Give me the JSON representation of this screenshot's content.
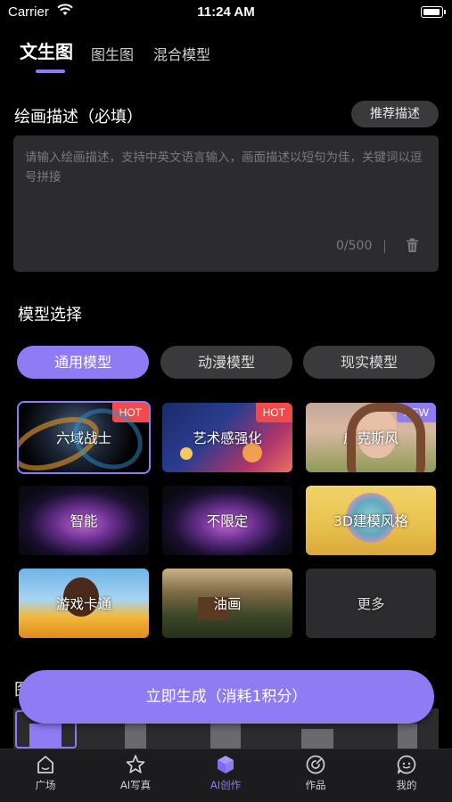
{
  "status": {
    "carrier": "Carrier",
    "time": "11:24 AM"
  },
  "tabs": [
    {
      "label": "文生图",
      "active": true
    },
    {
      "label": "图生图",
      "active": false
    },
    {
      "label": "混合模型",
      "active": false
    }
  ],
  "description": {
    "title": "绘画描述（必填）",
    "recommend_label": "推荐描述",
    "placeholder": "请输入绘画描述，支持中英文语言输入，画面描述以短句为佳，关键词以逗号拼接",
    "counter": "0/500"
  },
  "model": {
    "title": "模型选择",
    "categories": [
      {
        "label": "通用模型",
        "active": true
      },
      {
        "label": "动漫模型",
        "active": false
      },
      {
        "label": "现实模型",
        "active": false
      }
    ],
    "cards": [
      {
        "label": "六域战士",
        "badge": "HOT",
        "selected": true
      },
      {
        "label": "艺术感强化",
        "badge": "HOT"
      },
      {
        "label": "皮克斯风",
        "badge": "NEW"
      },
      {
        "label": "智能",
        "badge": ""
      },
      {
        "label": "不限定",
        "badge": ""
      },
      {
        "label": "3D建模风格",
        "badge": ""
      },
      {
        "label": "游戏卡通",
        "badge": ""
      },
      {
        "label": "油画",
        "badge": ""
      },
      {
        "label": "更多",
        "badge": ""
      }
    ]
  },
  "section_partial_title": "图",
  "generate": {
    "label": "立即生成（消耗1积分）"
  },
  "tabbar": [
    {
      "label": "广场",
      "icon": "home-icon",
      "active": false
    },
    {
      "label": "AI写真",
      "icon": "star-icon",
      "active": false
    },
    {
      "label": "AI创作",
      "icon": "cube-icon",
      "active": true
    },
    {
      "label": "作品",
      "icon": "works-icon",
      "active": false
    },
    {
      "label": "我的",
      "icon": "chat-face-icon",
      "active": false
    }
  ],
  "colors": {
    "accent": "#8f7cf5",
    "hot": "#f04a4a",
    "background": "#000000",
    "panel": "#2c2c2e"
  }
}
